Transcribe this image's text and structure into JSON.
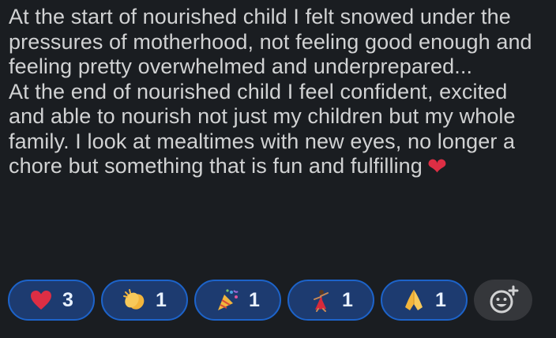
{
  "message": {
    "paragraphs": [
      "At the start of nourished child I felt snowed under the pressures of motherhood, not feeling good enough and feeling pretty overwhelmed and underprepared...",
      "At the end of nourished child I feel confident, excited and able to nourish not just my children but my whole family. I look at mealtimes with new eyes, no longer a chore but something that is fun and fulfilling"
    ],
    "trailing_emoji": "❤"
  },
  "reactions": [
    {
      "icon": "red-heart",
      "emoji": "❤",
      "count": "3",
      "color": "#dd2e44"
    },
    {
      "icon": "clapping-hands",
      "emoji": "👏",
      "count": "1",
      "color": "#f2b53c"
    },
    {
      "icon": "party-popper",
      "emoji": "🎉",
      "count": "1",
      "color": "#f2b53c"
    },
    {
      "icon": "dancer",
      "emoji": "💃",
      "count": "1",
      "color": "#d72a3a"
    },
    {
      "icon": "folded-hands",
      "emoji": "🙏",
      "count": "1",
      "color": "#f2b53c"
    }
  ],
  "add_reaction": {
    "icon": "add-emoji-icon"
  },
  "colors": {
    "background": "#1a1d21",
    "text": "#d1d2d3",
    "reaction_fill": "#1d3b70",
    "reaction_border": "#1d63c9",
    "add_reaction_fill": "#35373b"
  }
}
